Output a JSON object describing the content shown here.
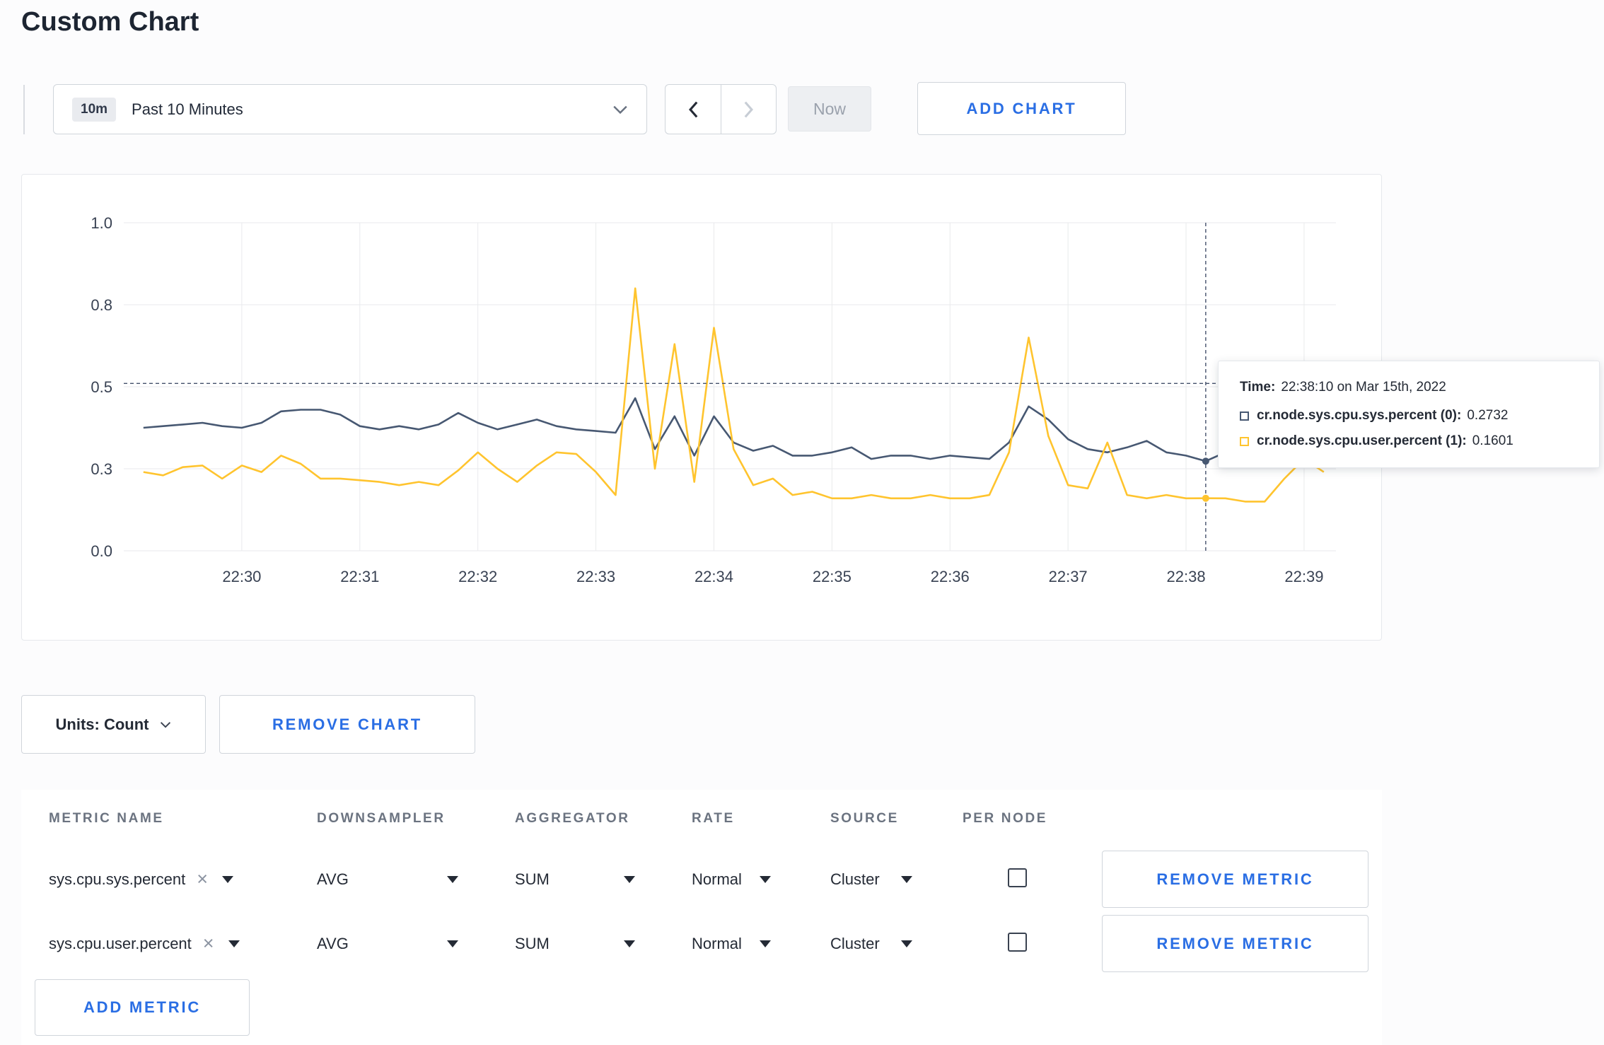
{
  "page": {
    "title": "Custom Chart"
  },
  "toolbar": {
    "range_badge": "10m",
    "range_label": "Past 10 Minutes",
    "now_label": "Now",
    "add_chart_label": "ADD CHART"
  },
  "colors": {
    "accent_blue": "#2a6ee4",
    "series_sys": "#475872",
    "series_user": "#ffc42e"
  },
  "chart_data": {
    "type": "line",
    "title": "",
    "xlabel": "",
    "ylabel": "",
    "ylim": [
      0,
      1
    ],
    "grid": true,
    "legend_position": "tooltip-only",
    "y_ticks": [
      "0.0",
      "0.3",
      "0.5",
      "0.8",
      "1.0"
    ],
    "y_tick_values": [
      0,
      0.25,
      0.5,
      0.75,
      1.0
    ],
    "x_ticks": [
      "22:30",
      "22:31",
      "22:32",
      "22:33",
      "22:34",
      "22:35",
      "22:36",
      "22:37",
      "22:38",
      "22:39"
    ],
    "x_tick_values": [
      30,
      31,
      32,
      33,
      34,
      35,
      36,
      37,
      38,
      39
    ],
    "x_axis_start": 29.0,
    "x_axis_end": 39.27,
    "x_start_minutes": 29.1666667,
    "x_interval_minutes": 0.1666667,
    "series": [
      {
        "name": "cr.node.sys.cpu.sys.percent",
        "color": "#475872",
        "values": [
          0.375,
          0.38,
          0.385,
          0.39,
          0.38,
          0.375,
          0.39,
          0.425,
          0.43,
          0.43,
          0.415,
          0.38,
          0.37,
          0.38,
          0.37,
          0.385,
          0.42,
          0.39,
          0.37,
          0.385,
          0.4,
          0.38,
          0.37,
          0.365,
          0.36,
          0.465,
          0.31,
          0.41,
          0.29,
          0.41,
          0.33,
          0.305,
          0.32,
          0.29,
          0.29,
          0.3,
          0.315,
          0.28,
          0.29,
          0.29,
          0.28,
          0.29,
          0.285,
          0.28,
          0.33,
          0.44,
          0.4,
          0.34,
          0.31,
          0.3,
          0.315,
          0.335,
          0.3,
          0.29,
          0.2732,
          0.3,
          0.32,
          0.31,
          0.3,
          0.305,
          0.3
        ]
      },
      {
        "name": "cr.node.sys.cpu.user.percent",
        "color": "#ffc42e",
        "values": [
          0.24,
          0.23,
          0.255,
          0.26,
          0.22,
          0.26,
          0.24,
          0.29,
          0.265,
          0.22,
          0.22,
          0.215,
          0.21,
          0.2,
          0.21,
          0.2,
          0.245,
          0.3,
          0.25,
          0.21,
          0.26,
          0.3,
          0.295,
          0.24,
          0.17,
          0.8,
          0.25,
          0.63,
          0.21,
          0.68,
          0.31,
          0.2,
          0.22,
          0.17,
          0.18,
          0.16,
          0.16,
          0.17,
          0.16,
          0.16,
          0.17,
          0.16,
          0.16,
          0.17,
          0.3,
          0.65,
          0.35,
          0.2,
          0.19,
          0.33,
          0.17,
          0.16,
          0.17,
          0.16,
          0.1601,
          0.16,
          0.15,
          0.15,
          0.22,
          0.28,
          0.24
        ]
      }
    ],
    "crosshair": {
      "x_minutes": 38.1666667,
      "y_value": 0.51
    },
    "hover_points": [
      {
        "series": 0,
        "value": 0.2732
      },
      {
        "series": 1,
        "value": 0.1601
      }
    ]
  },
  "tooltip": {
    "time_label": "Time:",
    "time_value": "22:38:10 on Mar 15th, 2022",
    "rows": [
      {
        "label": "cr.node.sys.cpu.sys.percent (0):",
        "value": "0.2732",
        "color": "#475872"
      },
      {
        "label": "cr.node.sys.cpu.user.percent (1):",
        "value": "0.1601",
        "color": "#ffc42e"
      }
    ]
  },
  "chart_controls": {
    "units_label": "Units: Count",
    "remove_chart_label": "REMOVE CHART"
  },
  "metrics_table": {
    "headers": [
      "METRIC NAME",
      "DOWNSAMPLER",
      "AGGREGATOR",
      "RATE",
      "SOURCE",
      "PER NODE"
    ],
    "rows": [
      {
        "metric": "sys.cpu.sys.percent",
        "downsampler": "AVG",
        "aggregator": "SUM",
        "rate": "Normal",
        "source": "Cluster",
        "per_node": false,
        "remove_label": "REMOVE METRIC"
      },
      {
        "metric": "sys.cpu.user.percent",
        "downsampler": "AVG",
        "aggregator": "SUM",
        "rate": "Normal",
        "source": "Cluster",
        "per_node": false,
        "remove_label": "REMOVE METRIC"
      }
    ],
    "add_metric_label": "ADD METRIC"
  }
}
